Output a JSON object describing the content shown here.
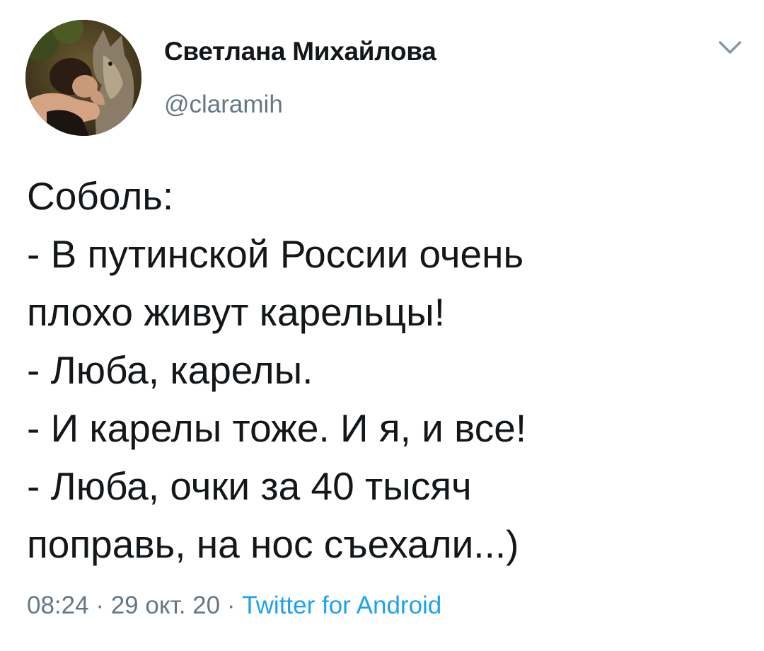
{
  "author": {
    "name": "Светлана Михайлова",
    "handle": "@claramih"
  },
  "icons": {
    "menu": "chevron-down-icon",
    "avatar": "avatar-photo"
  },
  "tweet": {
    "lines": [
      "Соболь:",
      "- В путинской России очень",
      "плохо живут карельцы!",
      "- Люба, карелы.",
      "- И карелы тоже. И я, и все!",
      "- Люба, очки за 40 тысяч",
      "поправь, на нос съехали...)"
    ]
  },
  "meta": {
    "time": "08:24",
    "separator": "·",
    "date": "29 окт. 20",
    "source": "Twitter for Android"
  },
  "colors": {
    "text": "#14171a",
    "secondary": "#657786",
    "link": "#1da1f2"
  }
}
